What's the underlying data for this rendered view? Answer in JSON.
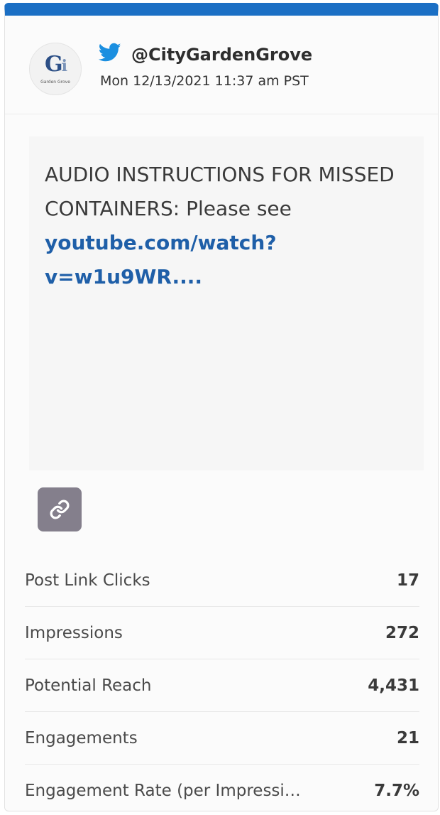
{
  "account": {
    "avatar_logo": "GG",
    "avatar_caption": "Garden Grove",
    "handle": "@CityGardenGrove",
    "timestamp": "Mon 12/13/2021 11:37 am PST",
    "network_icon": "twitter-bird-icon",
    "brand_color": "#1b6fc4"
  },
  "post": {
    "text_before_link": "AUDIO INSTRUCTIONS FOR MISSED CONTAINERS: Please see ",
    "link_text": "youtube.com/watch?v=w1u9WR....",
    "link_color": "#1f5fa8"
  },
  "link_button": {
    "icon": "link-chain-icon",
    "color": "#847f8c"
  },
  "stats": [
    {
      "label": "Post Link Clicks",
      "value": "17"
    },
    {
      "label": "Impressions",
      "value": "272"
    },
    {
      "label": "Potential Reach",
      "value": "4,431"
    },
    {
      "label": "Engagements",
      "value": "21"
    },
    {
      "label": "Engagement Rate (per Impressi…",
      "value": "7.7%"
    }
  ]
}
